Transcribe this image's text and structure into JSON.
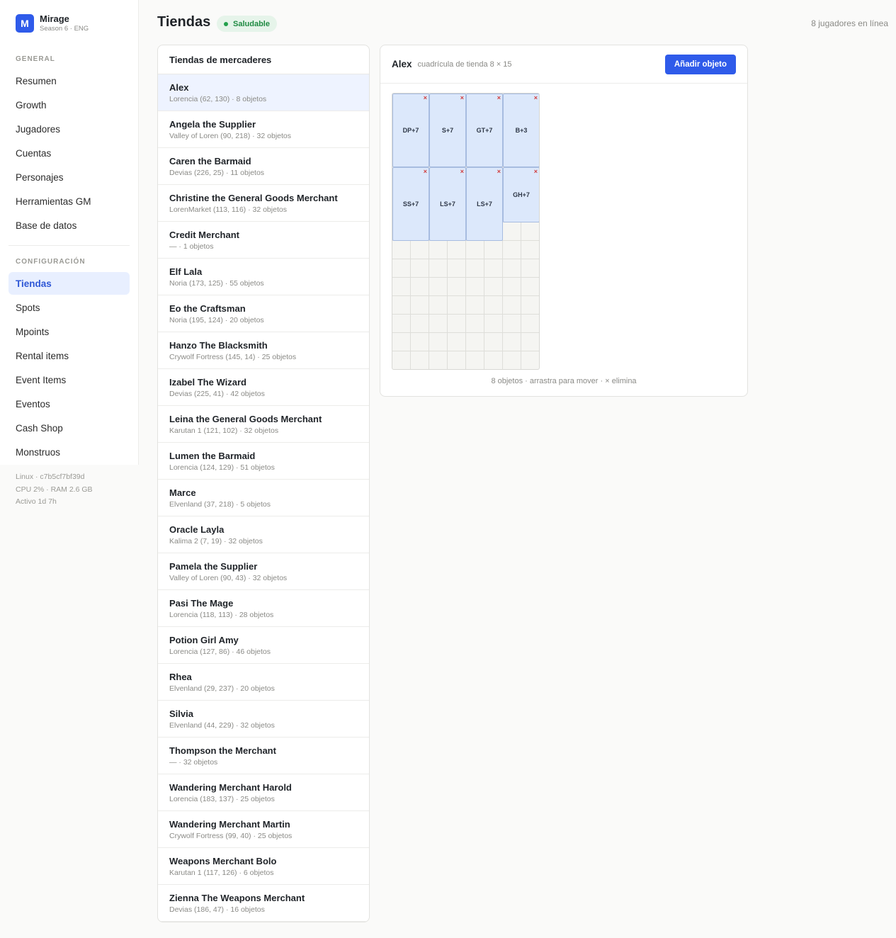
{
  "brand": {
    "initial": "M",
    "name": "Mirage",
    "subtitle": "Season 6 · ENG"
  },
  "sidebar": {
    "general_label": "GENERAL",
    "general_items": [
      "Resumen",
      "Growth",
      "Jugadores",
      "Cuentas",
      "Personajes",
      "Herramientas GM",
      "Base de datos"
    ],
    "config_label": "CONFIGURACIÓN",
    "config_items": [
      "Tiendas",
      "Spots",
      "Mpoints",
      "Rental items",
      "Event Items",
      "Eventos",
      "Cash Shop",
      "Monstruos"
    ],
    "active_item": "Tiendas"
  },
  "system": {
    "line1": "Linux · c7b5cf7bf39d",
    "line2": "CPU 2% · RAM 2.6 GB",
    "line3": "Activo 1d 7h"
  },
  "header": {
    "title": "Tiendas",
    "status": "Saludable",
    "online": "8 jugadores en línea"
  },
  "merchant_list": {
    "title": "Tiendas de mercaderes",
    "items": [
      {
        "name": "Alex",
        "meta": "Lorencia (62, 130) · 8 objetos"
      },
      {
        "name": "Angela the Supplier",
        "meta": "Valley of Loren (90, 218) · 32 objetos"
      },
      {
        "name": "Caren the Barmaid",
        "meta": "Devias (226, 25) · 11 objetos"
      },
      {
        "name": "Christine the General Goods Merchant",
        "meta": "LorenMarket (113, 116) · 32 objetos"
      },
      {
        "name": "Credit Merchant",
        "meta": "— · 1 objetos"
      },
      {
        "name": "Elf Lala",
        "meta": "Noria (173, 125) · 55 objetos"
      },
      {
        "name": "Eo the Craftsman",
        "meta": "Noria (195, 124) · 20 objetos"
      },
      {
        "name": "Hanzo The Blacksmith",
        "meta": "Crywolf Fortress (145, 14) · 25 objetos"
      },
      {
        "name": "Izabel The Wizard",
        "meta": "Devias (225, 41) · 42 objetos"
      },
      {
        "name": "Leina the General Goods Merchant",
        "meta": "Karutan 1 (121, 102) · 32 objetos"
      },
      {
        "name": "Lumen the Barmaid",
        "meta": "Lorencia (124, 129) · 51 objetos"
      },
      {
        "name": "Marce",
        "meta": "Elvenland (37, 218) · 5 objetos"
      },
      {
        "name": "Oracle Layla",
        "meta": "Kalima 2 (7, 19) · 32 objetos"
      },
      {
        "name": "Pamela the Supplier",
        "meta": "Valley of Loren (90, 43) · 32 objetos"
      },
      {
        "name": "Pasi The Mage",
        "meta": "Lorencia (118, 113) · 28 objetos"
      },
      {
        "name": "Potion Girl Amy",
        "meta": "Lorencia (127, 86) · 46 objetos"
      },
      {
        "name": "Rhea",
        "meta": "Elvenland (29, 237) · 20 objetos"
      },
      {
        "name": "Silvia",
        "meta": "Elvenland (44, 229) · 32 objetos"
      },
      {
        "name": "Thompson the Merchant",
        "meta": "— · 32 objetos"
      },
      {
        "name": "Wandering Merchant Harold",
        "meta": "Lorencia (183, 137) · 25 objetos"
      },
      {
        "name": "Wandering Merchant Martin",
        "meta": "Crywolf Fortress (99, 40) · 25 objetos"
      },
      {
        "name": "Weapons Merchant Bolo",
        "meta": "Karutan 1 (117, 126) · 6 objetos"
      },
      {
        "name": "Zienna The Weapons Merchant",
        "meta": "Devias (186, 47) · 16 objetos"
      }
    ],
    "selected": "Alex"
  },
  "detail": {
    "name": "Alex",
    "subtitle": "cuadrícula de tienda 8 × 15",
    "add_button": "Añadir objeto",
    "grid": {
      "cols": 8,
      "rows": 15
    },
    "items": [
      {
        "label": "DP+7",
        "col": 0,
        "row": 0,
        "w": 2,
        "h": 4
      },
      {
        "label": "S+7",
        "col": 2,
        "row": 0,
        "w": 2,
        "h": 4
      },
      {
        "label": "GT+7",
        "col": 4,
        "row": 0,
        "w": 2,
        "h": 4
      },
      {
        "label": "B+3",
        "col": 6,
        "row": 0,
        "w": 2,
        "h": 4
      },
      {
        "label": "SS+7",
        "col": 0,
        "row": 4,
        "w": 2,
        "h": 4
      },
      {
        "label": "LS+7",
        "col": 2,
        "row": 4,
        "w": 2,
        "h": 4
      },
      {
        "label": "LS+7",
        "col": 4,
        "row": 4,
        "w": 2,
        "h": 4
      },
      {
        "label": "GH+7",
        "col": 6,
        "row": 4,
        "w": 2,
        "h": 3
      }
    ],
    "remove_glyph": "×",
    "note": "8 objetos · arrastra para mover · × elimina"
  }
}
